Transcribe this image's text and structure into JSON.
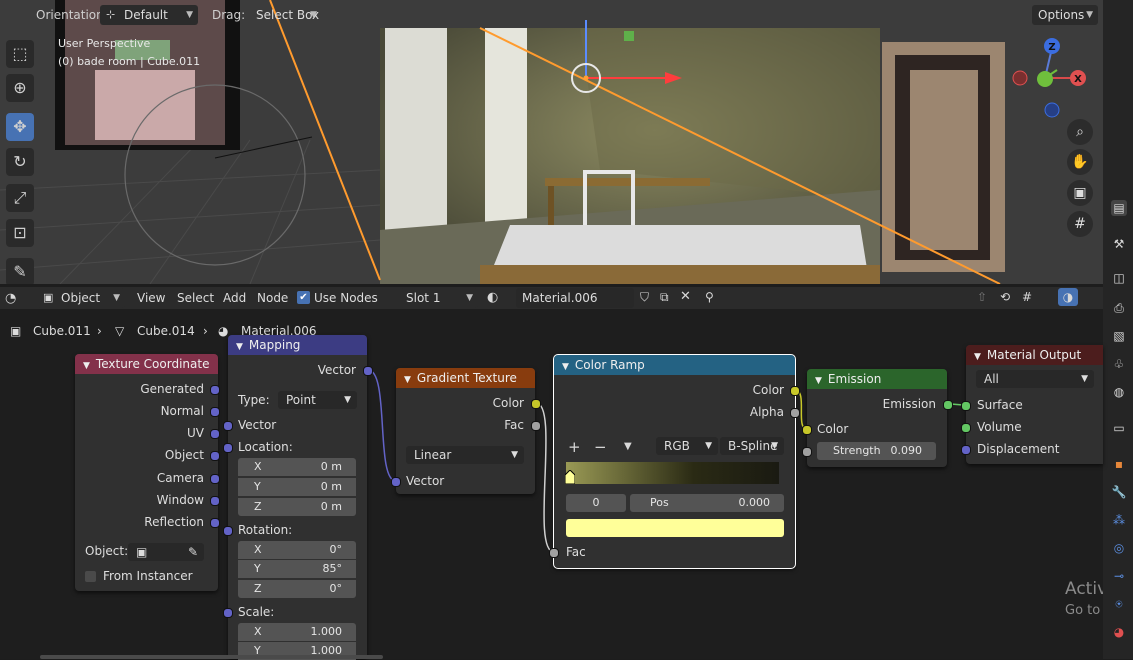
{
  "viewport": {
    "header": {
      "orientation_label": "Orientation:",
      "orientation_value": "Default",
      "drag_label": "Drag:",
      "drag_value": "Select Box",
      "options_label": "Options"
    },
    "overlay_line1": "User Perspective",
    "overlay_line2": "(0) bade room | Cube.011",
    "gizmo": {
      "z": "Z",
      "x": "X"
    },
    "watermark_line1": "Activat",
    "watermark_line2": "Go to Sett"
  },
  "node_editor": {
    "header": {
      "editor_type": "Object",
      "menus": [
        "View",
        "Select",
        "Add",
        "Node"
      ],
      "use_nodes_label": "Use Nodes",
      "use_nodes_checked": true,
      "slot": "Slot 1",
      "material": "Material.006"
    },
    "breadcrumb": [
      "Cube.011",
      "Cube.014",
      "Material.006"
    ],
    "nodes": {
      "texture_coordinate": {
        "title": "Texture Coordinate",
        "outputs": [
          "Generated",
          "Normal",
          "UV",
          "Object",
          "Camera",
          "Window",
          "Reflection"
        ],
        "object_label": "Object:",
        "from_instancer": "From Instancer"
      },
      "mapping": {
        "title": "Mapping",
        "output": "Vector",
        "type_label": "Type:",
        "type_value": "Point",
        "vector_label": "Vector",
        "location_label": "Location:",
        "location": [
          {
            "axis": "X",
            "value": "0 m"
          },
          {
            "axis": "Y",
            "value": "0 m"
          },
          {
            "axis": "Z",
            "value": "0 m"
          }
        ],
        "rotation_label": "Rotation:",
        "rotation": [
          {
            "axis": "X",
            "value": "0°"
          },
          {
            "axis": "Y",
            "value": "85°"
          },
          {
            "axis": "Z",
            "value": "0°"
          }
        ],
        "scale_label": "Scale:",
        "scale": [
          {
            "axis": "X",
            "value": "1.000"
          },
          {
            "axis": "Y",
            "value": "1.000"
          }
        ]
      },
      "gradient_texture": {
        "title": "Gradient Texture",
        "outputs": [
          "Color",
          "Fac"
        ],
        "type_value": "Linear",
        "input": "Vector"
      },
      "color_ramp": {
        "title": "Color Ramp",
        "outputs": [
          "Color",
          "Alpha"
        ],
        "add": "+",
        "remove": "−",
        "mode": "RGB",
        "interpolation": "B-Spline",
        "stop_index": "0",
        "pos_label": "Pos",
        "pos_value": "0.000",
        "swatch_color": "#ffff99",
        "input": "Fac"
      },
      "emission": {
        "title": "Emission",
        "output": "Emission",
        "color_input": "Color",
        "strength_label": "Strength",
        "strength_value": "0.090"
      },
      "material_output": {
        "title": "Material Output",
        "target": "All",
        "inputs": [
          "Surface",
          "Volume",
          "Displacement"
        ]
      }
    }
  },
  "colors": {
    "accent": "#4772b3",
    "header_texcoord": "#83314a",
    "header_vector": "#3c3c83",
    "header_texture": "#883c0e",
    "header_converter": "#246283",
    "header_shader": "#2b652b",
    "header_output": "#4c1d1d"
  }
}
